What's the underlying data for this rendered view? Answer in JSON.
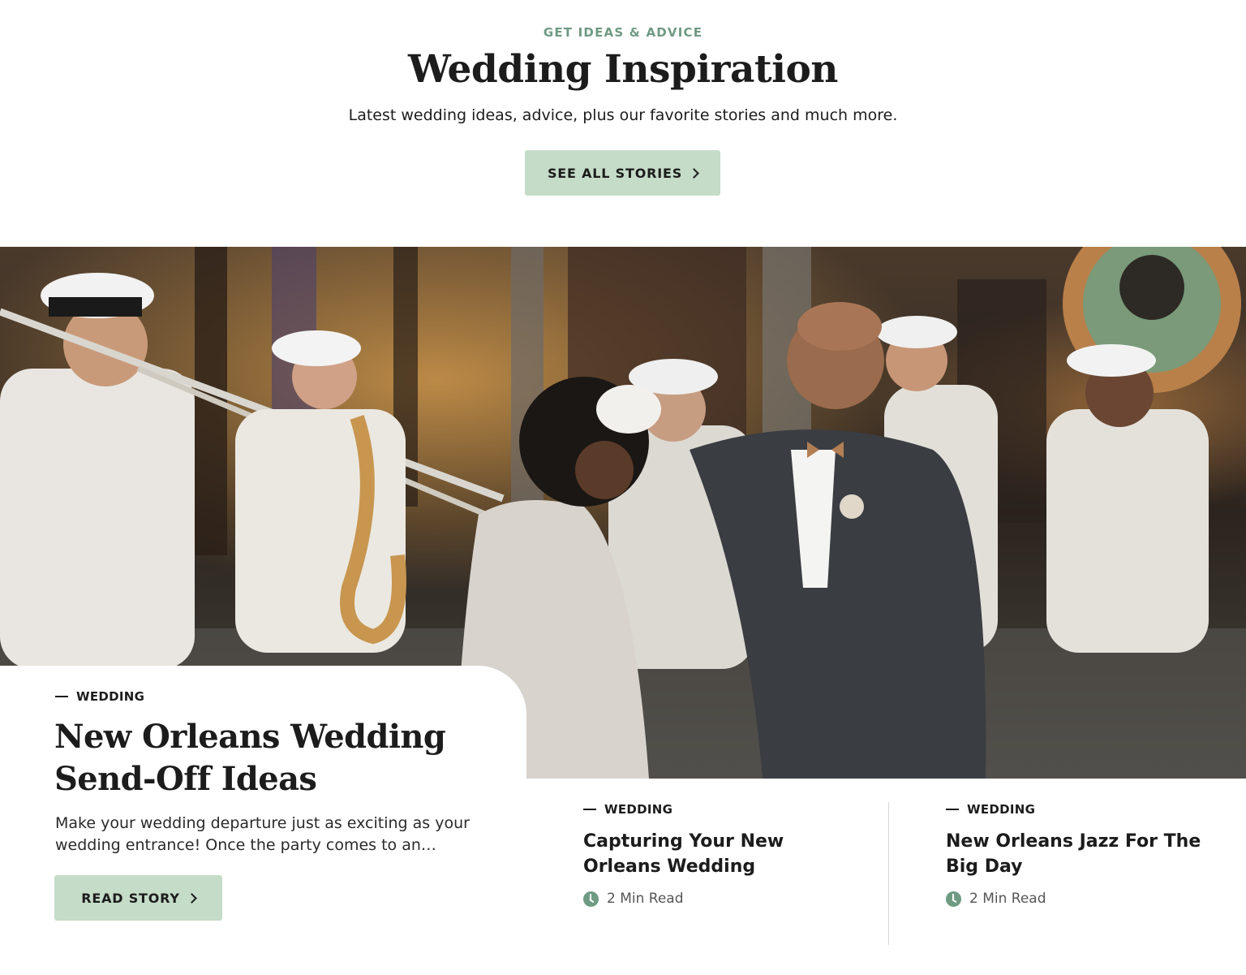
{
  "header": {
    "eyebrow": "GET IDEAS & ADVICE",
    "title": "Wedding Inspiration",
    "subtitle": "Latest wedding ideas, advice, plus our favorite stories and much more.",
    "cta_label": "SEE ALL STORIES"
  },
  "hero": {
    "category": "WEDDING",
    "title": "New Orleans Wedding Send-Off Ideas",
    "description": "Make your wedding departure just as exciting as your wedding entrance! Once the party comes to an…",
    "cta_label": "READ STORY"
  },
  "stories": [
    {
      "category": "WEDDING",
      "title": "Capturing Your New Orleans Wedding",
      "read_time": "2 Min Read"
    },
    {
      "category": "WEDDING",
      "title": "New Orleans Jazz For The Big Day",
      "read_time": "2 Min Read"
    }
  ],
  "colors": {
    "accent": "#6f9a84",
    "button_bg": "#c5dcc8",
    "text": "#1c1c1c"
  },
  "icons": {
    "button_arrow": "chevron-right-icon",
    "read_time": "clock-icon",
    "category_marker": "dash-icon"
  }
}
